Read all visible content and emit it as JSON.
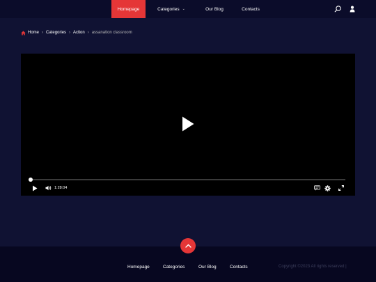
{
  "header": {
    "nav": [
      {
        "label": "Homepage",
        "active": true
      },
      {
        "label": "Categories",
        "active": false,
        "has_dropdown": true
      },
      {
        "label": "Our Blog",
        "active": false
      },
      {
        "label": "Contacts",
        "active": false
      }
    ],
    "dropdown_glyph": "⌄",
    "icons": [
      "search-icon",
      "user-icon"
    ]
  },
  "breadcrumb": {
    "items": [
      "Home",
      "Categories",
      "Action"
    ],
    "current": "assanation classroom",
    "separator": "›",
    "home_icon": "home-icon"
  },
  "player": {
    "time": "1:28:04",
    "progress": 0,
    "controls": [
      "play-icon",
      "volume-icon",
      "captions-icon",
      "settings-icon",
      "fullscreen-icon"
    ]
  },
  "footer": {
    "nav": [
      "Homepage",
      "Categories",
      "Our Blog",
      "Contacts"
    ],
    "copyright": "Copyright ©2023 All rights reserved |",
    "back_to_top_icon": "chevron-up-icon"
  },
  "colors": {
    "accent": "#e53637",
    "header_bg": "#0b0c2a",
    "main_bg": "#101233",
    "footer_bg": "#070720",
    "player_bg": "#000000"
  }
}
